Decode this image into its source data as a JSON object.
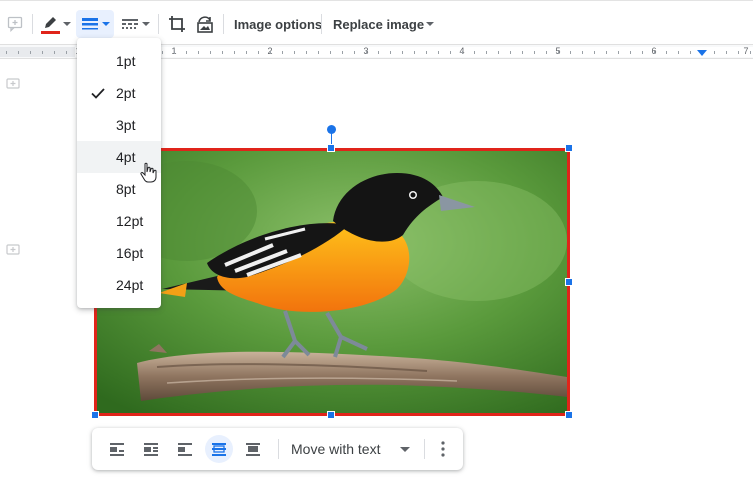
{
  "toolbar": {
    "image_options_label": "Image options",
    "replace_image_label": "Replace image",
    "border_color": "#e0241a",
    "accent": "#1a73e8"
  },
  "ruler": {
    "numbers": [
      "1",
      "1",
      "2",
      "3",
      "4",
      "5",
      "6",
      "7"
    ]
  },
  "border_weight_menu": {
    "options": [
      "1pt",
      "2pt",
      "3pt",
      "4pt",
      "8pt",
      "12pt",
      "16pt",
      "24pt"
    ],
    "selected": "2pt",
    "hovered": "4pt"
  },
  "image_toolbar": {
    "wrap_mode_label": "Move with text",
    "buttons": [
      "in-line",
      "wrap-text",
      "break-text",
      "behind-text",
      "in-front-of-text"
    ],
    "active": "behind-text"
  },
  "image": {
    "subject": "bird-on-branch",
    "border_color": "#e0241a"
  }
}
